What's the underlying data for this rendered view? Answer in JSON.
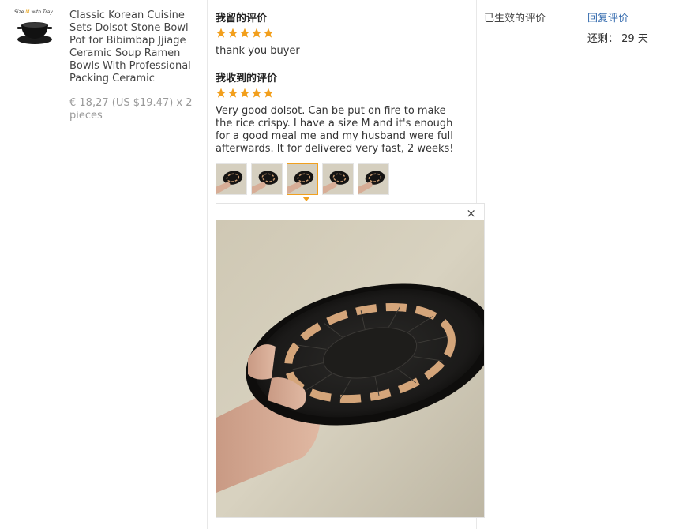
{
  "product": {
    "thumb_caption_prefix": "Size",
    "thumb_caption_size": "M",
    "thumb_caption_suffix": "with Tray",
    "title": "Classic Korean Cuisine Sets Dolsot Stone Bowl Pot for Bibimbap Jjiage Ceramic Soup Ramen Bowls With Professional Packing Ceramic",
    "price": "€ 18,27 (US $19.47) x 2 pieces"
  },
  "feedback": {
    "my_heading": "我留的评价",
    "my_rating": 5,
    "my_text": "thank you buyer",
    "received_heading": "我收到的评价",
    "received_rating": 5,
    "received_text": "Very good dolsot. Can be put on fire to make the rice crispy. I have a size M and it's enough for a good meal me and my husband were full afterwards. It for delivered very fast, 2 weeks!",
    "photo_count": 5,
    "selected_photo_index": 2,
    "close_symbol": "×"
  },
  "status": {
    "label": "已生效的评价"
  },
  "actions": {
    "reply_label": "回复评价",
    "remaining_label": "还剩：",
    "remaining_value": "29 天"
  },
  "colors": {
    "star": "#f29f1c",
    "link": "#3a6fb0",
    "selected_border": "#f0a020",
    "price": "#999999"
  },
  "icons": {
    "star": "star-icon",
    "close": "close-icon"
  }
}
